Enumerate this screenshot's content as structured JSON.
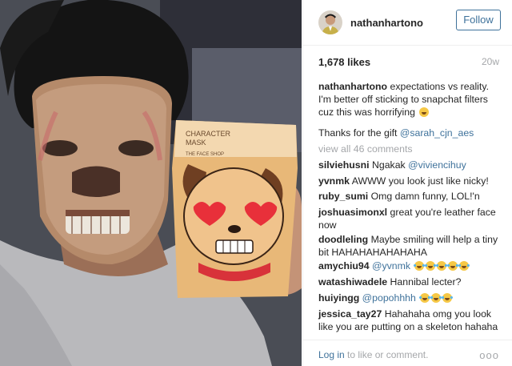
{
  "post": {
    "image_label": "selfie with character mask",
    "mask_packaging_text_1": "CHARACTER",
    "mask_packaging_text_2": "MASK",
    "mask_packaging_text_3": "THE FACE SHOP"
  },
  "header": {
    "username": "nathanhartono",
    "follow_label": "Follow"
  },
  "stats": {
    "likes": "1,678 likes",
    "time": "20w"
  },
  "comments": [
    {
      "user": "nathanhartono",
      "text": "expectations vs reality. I'm better off sticking to snapchat filters cuz this was horrifying"
    },
    {
      "user": "",
      "text": "Thanks for the gift ",
      "mention": "@sarah_cjn_aes"
    },
    {
      "view_all": "view all 46 comments"
    },
    {
      "user": "silviehusni",
      "text": "Ngakak ",
      "mention": "@viviencihuy"
    },
    {
      "user": "yvnmk",
      "text": "AWWW you look just like nicky!"
    },
    {
      "user": "ruby_sumi",
      "text": "Omg damn funny, LOL!'n"
    },
    {
      "user": "joshuasimonxl",
      "text": "great you're leather face now"
    },
    {
      "user": "doodleling",
      "text": "Maybe smiling will help a tiny bit HAHAHAHAHAHAHA"
    },
    {
      "user": "amychiu94",
      "mention": "@yvnmk"
    },
    {
      "user": "watashiwadele",
      "text": "Hannibal lecter?"
    },
    {
      "user": "huiyingg",
      "mention": "@popohhhh"
    },
    {
      "user": "jessica_tay27",
      "text": "Hahahaha omg you look like you are putting on a skeleton hahaha"
    }
  ],
  "footer": {
    "login_link": "Log in",
    "login_rest": " to like or comment.",
    "more": "ooo"
  },
  "colors": {
    "link": "#3f729b",
    "muted": "#a5a7aa",
    "text": "#262626"
  }
}
